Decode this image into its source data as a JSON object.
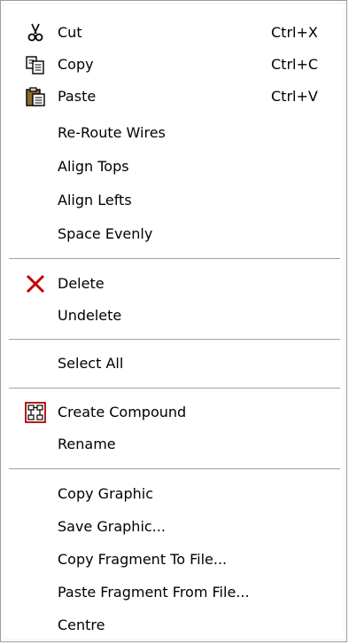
{
  "menu": {
    "items": [
      {
        "label": "Cut",
        "shortcut": "Ctrl+X",
        "icon": "scissors-icon"
      },
      {
        "label": "Copy",
        "shortcut": "Ctrl+C",
        "icon": "copy-icon"
      },
      {
        "label": "Paste",
        "shortcut": "Ctrl+V",
        "icon": "clipboard-icon"
      },
      {
        "label": "Re-Route Wires"
      },
      {
        "label": "Align Tops"
      },
      {
        "label": "Align Lefts"
      },
      {
        "label": "Space Evenly"
      },
      {
        "label": "Delete",
        "icon": "delete-x-icon"
      },
      {
        "label": "Undelete"
      },
      {
        "label": "Select All"
      },
      {
        "label": "Create Compound",
        "icon": "compound-icon"
      },
      {
        "label": "Rename"
      },
      {
        "label": "Copy Graphic"
      },
      {
        "label": "Save Graphic..."
      },
      {
        "label": "Copy Fragment To File..."
      },
      {
        "label": "Paste Fragment From File..."
      },
      {
        "label": "Centre"
      }
    ]
  },
  "colors": {
    "delete_x": "#c00000",
    "separator": "#a0a0a0",
    "compound_border": "#b00000"
  }
}
